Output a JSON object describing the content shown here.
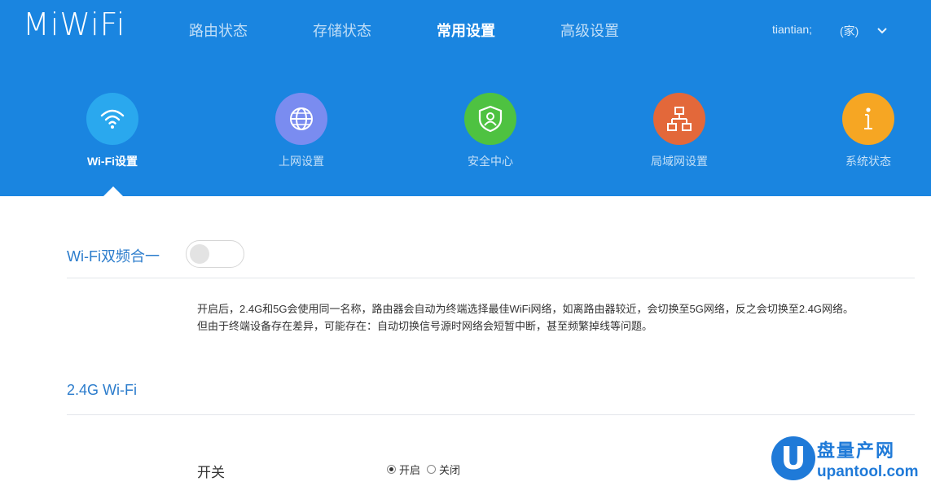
{
  "brand": "MiWiFi",
  "nav": {
    "items": [
      "路由状态",
      "存储状态",
      "常用设置",
      "高级设置"
    ],
    "active": "常用设置"
  },
  "user": {
    "name": "tiantian;",
    "location": "(家)"
  },
  "categories": [
    {
      "label": "Wi-Fi设置",
      "icon": "wifi-icon",
      "color": "#2aa8ee",
      "active": true
    },
    {
      "label": "上网设置",
      "icon": "globe-icon",
      "color": "#7a8cf0",
      "active": false
    },
    {
      "label": "安全中心",
      "icon": "shield-user-icon",
      "color": "#4ec241",
      "active": false
    },
    {
      "label": "局域网设置",
      "icon": "network-icon",
      "color": "#e3683a",
      "active": false
    },
    {
      "label": "系统状态",
      "icon": "info-icon",
      "color": "#f6a623",
      "active": false
    }
  ],
  "dual_band": {
    "title": "Wi-Fi双频合一",
    "enabled": false,
    "desc_line1": "开启后，2.4G和5G会使用同一名称，路由器会自动为终端选择最佳WiFi网络，如离路由器较近，会切换至5G网络，反之会切换至2.4G网络。",
    "desc_line2": "但由于终端设备存在差异，可能存在：自动切换信号源时网络会短暂中断，甚至频繁掉线等问题。"
  },
  "wifi24": {
    "title": "2.4G Wi-Fi",
    "switch_label": "开关",
    "options": [
      "开启",
      "关闭"
    ],
    "selected": "开启"
  },
  "watermark": {
    "glyph": "U",
    "cn": "盘量产网",
    "url": "upantool.com"
  },
  "colors": {
    "header_bg": "#1a85e0",
    "title_blue": "#2b7ccc"
  }
}
